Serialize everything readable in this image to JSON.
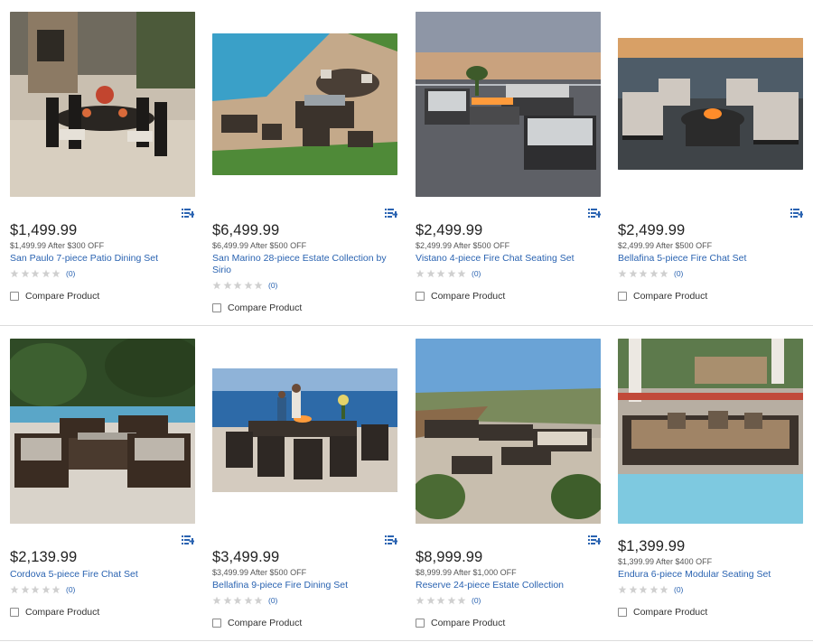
{
  "products": [
    {
      "price": "$1,499.99",
      "subprice": "$1,499.99 After $300 OFF",
      "title": "San Paulo 7-piece Patio Dining Set",
      "review_count": "(0)",
      "compare_label": "Compare Product",
      "image_icon": "patio-dining-set-image"
    },
    {
      "price": "$6,499.99",
      "subprice": "$6,499.99 After $500 OFF",
      "title": "San Marino 28-piece Estate Collection by Sirio",
      "review_count": "(0)",
      "compare_label": "Compare Product",
      "image_icon": "estate-collection-image"
    },
    {
      "price": "$2,499.99",
      "subprice": "$2,499.99 After $500 OFF",
      "title": "Vistano 4-piece Fire Chat Seating Set",
      "review_count": "(0)",
      "compare_label": "Compare Product",
      "image_icon": "fire-chat-seating-image"
    },
    {
      "price": "$2,499.99",
      "subprice": "$2,499.99 After $500 OFF",
      "title": "Bellafina 5-piece Fire Chat Set",
      "review_count": "(0)",
      "compare_label": "Compare Product",
      "image_icon": "fire-chat-set-image"
    },
    {
      "price": "$2,139.99",
      "subprice": "",
      "title": "Cordova 5-piece Fire Chat Set",
      "review_count": "(0)",
      "compare_label": "Compare Product",
      "image_icon": "wicker-fire-chat-image"
    },
    {
      "price": "$3,499.99",
      "subprice": "$3,499.99 After $500 OFF",
      "title": "Bellafina 9-piece Fire Dining Set",
      "review_count": "(0)",
      "compare_label": "Compare Product",
      "image_icon": "fire-dining-set-image"
    },
    {
      "price": "$8,999.99",
      "subprice": "$8,999.99 After $1,000 OFF",
      "title": "Reserve 24-piece Estate Collection",
      "review_count": "(0)",
      "compare_label": "Compare Product",
      "image_icon": "reserve-estate-image"
    },
    {
      "price": "$1,399.99",
      "subprice": "$1,399.99 After $400 OFF",
      "title": "Endura 6-piece Modular Seating Set",
      "review_count": "(0)",
      "compare_label": "Compare Product",
      "image_icon": "modular-seating-image"
    }
  ],
  "colors": {
    "link": "#2a63b1",
    "price": "#222222",
    "star_empty": "#d0d0d0",
    "icon_blue": "#2a63b1"
  }
}
